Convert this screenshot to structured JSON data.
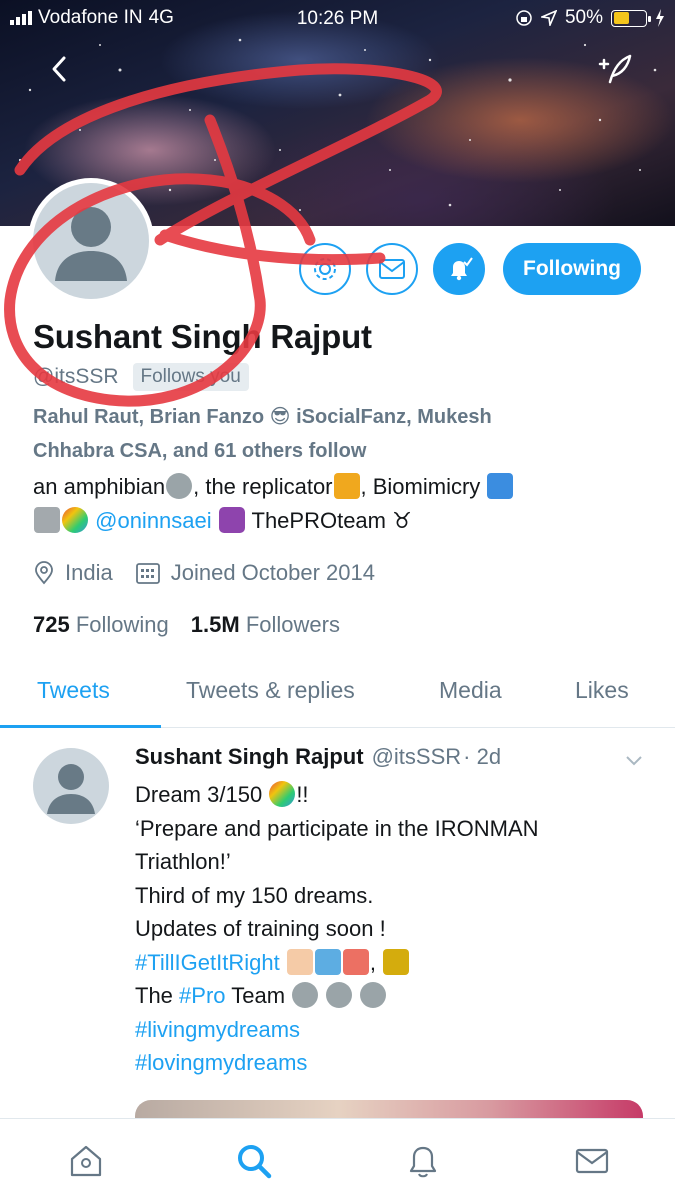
{
  "status_bar": {
    "carrier": "Vodafone IN",
    "network": "4G",
    "time": "10:26 PM",
    "battery": "50%",
    "battery_level": 0.5
  },
  "header": {
    "back_icon": "chevron-left-icon",
    "compose_icon": "compose-quill-icon"
  },
  "profile": {
    "name": "Sushant Singh Rajput",
    "handle": "@itsSSR",
    "follows_you": "Follows you",
    "followed_by_lines": [
      "Rahul Raut, Brian Fanzo 😎 iSocialFanz, Mukesh",
      "Chhabra CSA, and 61 others follow"
    ],
    "bio_line1_a": "an amphibian",
    "bio_line1_b": ", the replicator",
    "bio_line1_c": ", Biomimicry",
    "bio_mention": "@oninnsaei",
    "bio_line2_end": "ThePROteam",
    "location": "India",
    "joined": "Joined October 2014",
    "following_count": "725",
    "following_label": "Following",
    "followers_count": "1.5M",
    "followers_label": "Followers"
  },
  "buttons": {
    "following": "Following"
  },
  "tabs": [
    {
      "label": "Tweets",
      "active": true
    },
    {
      "label": "Tweets & replies",
      "active": false
    },
    {
      "label": "Media",
      "active": false
    },
    {
      "label": "Likes",
      "active": false
    }
  ],
  "tweet": {
    "author": "Sushant Singh Rajput",
    "handle": "@itsSSR",
    "time": "· 2d",
    "line1": "Dream 3/150",
    "line1_end": "!!",
    "line2": "‘Prepare and participate in the IRONMAN",
    "line3": "Triathlon!’",
    "line4": "Third of my 150 dreams.",
    "line5": "Updates of training soon !",
    "hashtag1": "#TillIGetItRight",
    "line7_a": "The ",
    "hashtag2": "#Pro",
    "line7_b": " Team",
    "hashtag3": "#livingmydreams",
    "hashtag4": "#lovingmydreams"
  },
  "bottom_nav": [
    {
      "icon": "home-icon"
    },
    {
      "icon": "search-icon"
    },
    {
      "icon": "bell-icon"
    },
    {
      "icon": "mail-icon"
    }
  ],
  "colors": {
    "accent": "#1da1f2",
    "text": "#14171a",
    "muted": "#657786",
    "scribble": "#e53940"
  }
}
